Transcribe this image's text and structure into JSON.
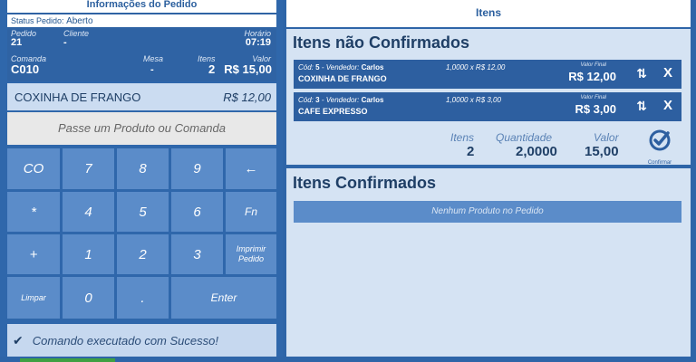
{
  "order": {
    "header": "Informações do Pedido",
    "status_label": "Status Pedido:",
    "status_value": "Aberto",
    "pedido_label": "Pedido",
    "pedido_value": "21",
    "cliente_label": "Cliente",
    "cliente_value": "-",
    "horario_label": "Horário",
    "horario_value": "07:19",
    "comanda_label": "Comanda",
    "comanda_value": "C010",
    "mesa_label": "Mesa",
    "mesa_value": "-",
    "itens_label": "Itens",
    "itens_value": "2",
    "valor_label": "Valor",
    "valor_value": "R$ 15,00"
  },
  "current_product": {
    "name": "COXINHA DE FRANGO",
    "price": "R$ 12,00"
  },
  "product_input": {
    "placeholder": "Passe um Produto ou Comanda"
  },
  "keypad": {
    "keys": {
      "co": "CO",
      "k7": "7",
      "k8": "8",
      "k9": "9",
      "backspace": "←",
      "star": "*",
      "k4": "4",
      "k5": "5",
      "k6": "6",
      "fn": "Fn",
      "plus": "+",
      "k1": "1",
      "k2": "2",
      "k3": "3",
      "print_line1": "Imprimir",
      "print_line2": "Pedido",
      "clear": "Limpar",
      "k0": "0",
      "dot": ".",
      "enter": "Enter"
    }
  },
  "status_message": {
    "icon": "check-icon",
    "text": "Comando executado com Sucesso!"
  },
  "items_panel": {
    "header": "Itens",
    "unconfirmed_title": "Itens não Confirmados",
    "unconfirmed": [
      {
        "code_label": "Cód:",
        "code": "5",
        "seller_label": "- Vendedor:",
        "seller": "Carlos",
        "name": "COXINHA DE FRANGO",
        "qty_price": "1,0000 x R$ 12,00",
        "final_label": "Valor Final",
        "final_value": "R$ 12,00"
      },
      {
        "code_label": "Cód:",
        "code": "3",
        "seller_label": "- Vendedor:",
        "seller": "Carlos",
        "name": "CAFE EXPRESSO",
        "qty_price": "1,0000 x R$ 3,00",
        "final_label": "Valor Final",
        "final_value": "R$ 3,00"
      }
    ],
    "totals": {
      "itens_label": "Itens",
      "itens_value": "2",
      "quantidade_label": "Quantidade",
      "quantidade_value": "2,0000",
      "valor_label": "Valor",
      "valor_value": "15,00"
    },
    "confirm_label": "Confirmar",
    "confirmed_title": "Itens Confirmados",
    "empty_text": "Nenhum Produto no Pedido"
  },
  "colors": {
    "accent": "#2d5fa0",
    "key": "#5b8cc9",
    "panel_bg": "#d5e3f3",
    "success_strip": "#3fa043"
  }
}
